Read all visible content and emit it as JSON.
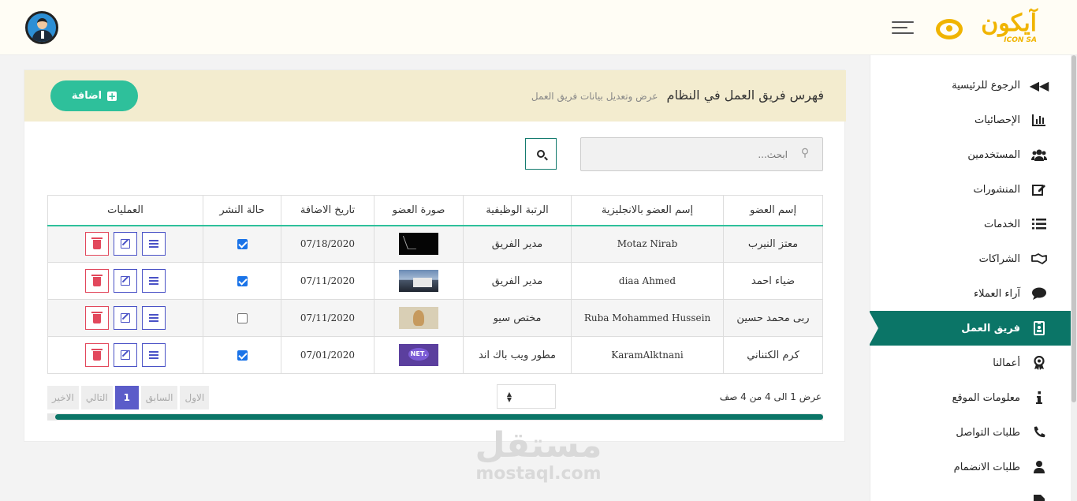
{
  "topbar": {
    "logo_ar": "آيكون",
    "logo_en": "ICON SA"
  },
  "sidebar": {
    "items": [
      {
        "label": "الرجوع للرئيسية",
        "icon": "fast-backward-icon"
      },
      {
        "label": "الإحصائيات",
        "icon": "bar-chart-icon"
      },
      {
        "label": "المستخدمين",
        "icon": "users-icon"
      },
      {
        "label": "المنشورات",
        "icon": "edit-icon"
      },
      {
        "label": "الخدمات",
        "icon": "list-icon"
      },
      {
        "label": "الشراكات",
        "icon": "handshake-icon"
      },
      {
        "label": "آراء العملاء",
        "icon": "comment-icon"
      },
      {
        "label": "فريق العمل",
        "icon": "id-badge-icon",
        "active": true
      },
      {
        "label": "أعمالنا",
        "icon": "award-icon"
      },
      {
        "label": "معلومات الموقع",
        "icon": "info-icon"
      },
      {
        "label": "طلبات التواصل",
        "icon": "phone-icon"
      },
      {
        "label": "طلبات الانضمام",
        "icon": "user-icon"
      }
    ],
    "active_color": "#0b7567"
  },
  "header": {
    "title": "فهرس فريق العمل في النظام",
    "subtitle": "عرض وتعديل بيانات فريق العمل",
    "add_label": "اضافة"
  },
  "search": {
    "placeholder": "ابحث..."
  },
  "table": {
    "columns": [
      "إسم العضو",
      "إسم العضو بالانجليزية",
      "الرتبة الوظيفية",
      "صورة العضو",
      "تاريخ الاضافة",
      "حالة النشر",
      "العمليات"
    ],
    "rows": [
      {
        "name": "معتز النيرب",
        "name_en": "Motaz Nirab",
        "rank": "مدير الفريق",
        "date": "07/18/2020",
        "published": true
      },
      {
        "name": "ضياء احمد",
        "name_en": "diaa Ahmed",
        "rank": "مدير الفريق",
        "date": "07/11/2020",
        "published": true
      },
      {
        "name": "ربى محمد حسين",
        "name_en": "Ruba Mohammed Hussein",
        "rank": "مختص سيو",
        "date": "07/11/2020",
        "published": false
      },
      {
        "name": "كرم الكتناني",
        "name_en": "KaramAlktnani",
        "rank": "مطور ويب باك اند",
        "date": "07/01/2020",
        "published": true
      }
    ]
  },
  "thumbs": {
    "net_label": ".NET"
  },
  "pagination": {
    "first": "الاول",
    "prev": "السابق",
    "current": "1",
    "next": "التالي",
    "last": "الاخير"
  },
  "summary": "عرض 1 الى 4 من 4 صف",
  "scroll_progress": 0.99,
  "watermark": {
    "ar": "مستقل",
    "en": "mostaql.com"
  },
  "colors": {
    "accent": "#2ec09b",
    "header_bg": "#f3eccf",
    "primary": "#5b5cc9",
    "danger": "#e2485c"
  }
}
